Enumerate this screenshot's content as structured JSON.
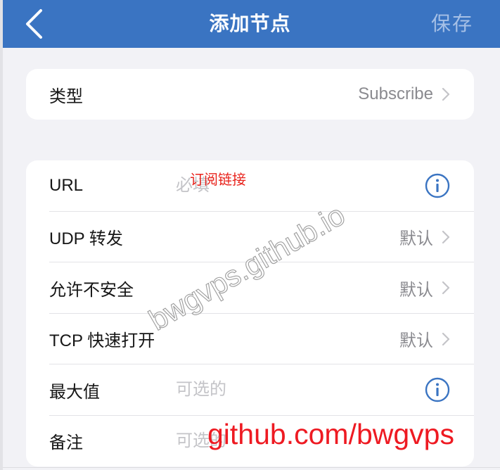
{
  "navbar": {
    "title": "添加节点",
    "save_label": "保存",
    "back_icon": "chevron-left-icon"
  },
  "type_section": {
    "label": "类型",
    "value": "Subscribe",
    "icon": "chevron-right-icon"
  },
  "fields": [
    {
      "label": "URL",
      "placeholder": "必填",
      "icon": "info-icon"
    },
    {
      "label": "UDP 转发",
      "value": "默认",
      "icon": "chevron-right-icon"
    },
    {
      "label": "允许不安全",
      "value": "默认",
      "icon": "chevron-right-icon"
    },
    {
      "label": "TCP 快速打开",
      "value": "默认",
      "icon": "chevron-right-icon"
    },
    {
      "label": "最大值",
      "placeholder": "可选的",
      "icon": "info-icon"
    },
    {
      "label": "备注",
      "placeholder": "可选的"
    }
  ],
  "annotations": {
    "url_hint": "订阅链接",
    "footer_link": "github.com/bwgvps",
    "watermark": "bwgvps.github.io"
  },
  "colors": {
    "navbar": "#3A74C2",
    "background": "#F2F2F6",
    "accent": "#3A74C2",
    "annotation": "#E8231C"
  }
}
